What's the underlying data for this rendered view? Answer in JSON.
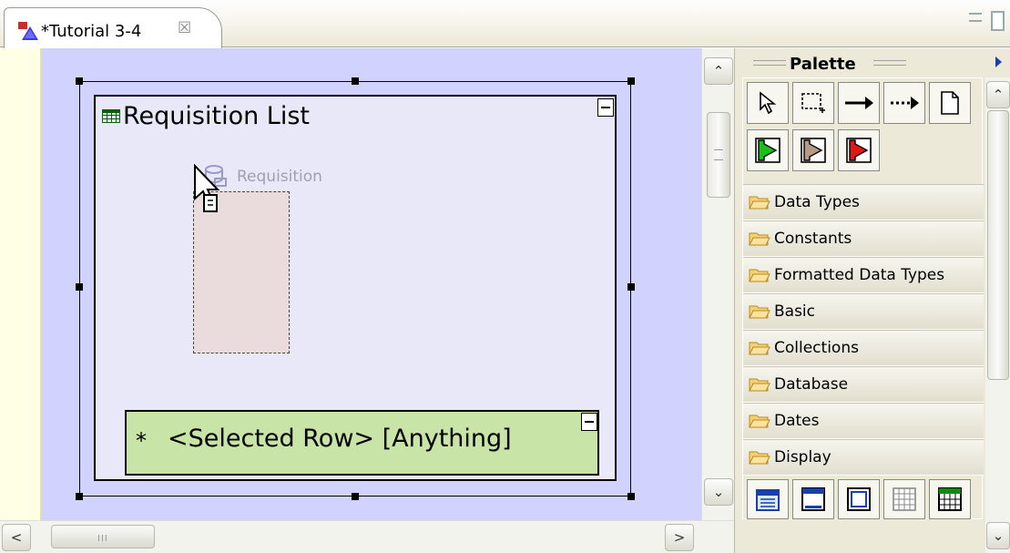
{
  "editor_tab": {
    "title": "*Tutorial 3-4",
    "close_glyph": "☒"
  },
  "canvas": {
    "background": "#d2d2ff",
    "requisition_list": {
      "title": "Requisition List"
    },
    "drag_feedback": {
      "label": "Requisition"
    },
    "selected_row": {
      "star": "*",
      "label": "<Selected Row> [Anything]"
    }
  },
  "scrollbars": {
    "up": "⌃",
    "down": "⌄",
    "left": "<",
    "right": ">",
    "grip": "III"
  },
  "palette": {
    "title": "Palette",
    "tools": [
      {
        "name": "select-tool",
        "icon": "arrow-pointer-icon"
      },
      {
        "name": "marquee-tool",
        "icon": "marquee-icon"
      },
      {
        "name": "connection-tool",
        "icon": "solid-arrow-icon"
      },
      {
        "name": "dashed-connection-tool",
        "icon": "dashed-arrow-icon"
      },
      {
        "name": "note-tool",
        "icon": "note-icon"
      },
      {
        "name": "green-flag-tool",
        "icon": "green-flag-icon"
      },
      {
        "name": "brown-flag-tool",
        "icon": "brown-flag-icon"
      },
      {
        "name": "red-flag-tool",
        "icon": "red-flag-icon"
      }
    ],
    "drawers": [
      {
        "label": "Data Types"
      },
      {
        "label": "Constants"
      },
      {
        "label": "Formatted Data Types"
      },
      {
        "label": "Basic"
      },
      {
        "label": "Collections"
      },
      {
        "label": "Database"
      },
      {
        "label": "Dates"
      },
      {
        "label": "Display"
      }
    ],
    "display_items": [
      {
        "icon": "calendar-icon"
      },
      {
        "icon": "window-icon"
      },
      {
        "icon": "frame-icon"
      },
      {
        "icon": "grid-icon"
      },
      {
        "icon": "table-icon"
      }
    ]
  }
}
